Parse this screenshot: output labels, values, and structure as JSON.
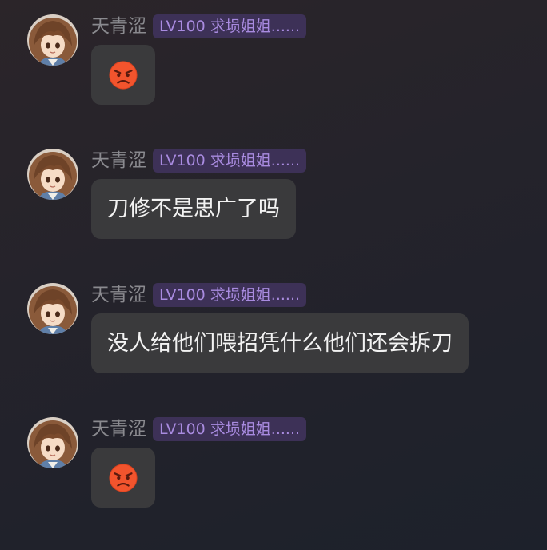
{
  "messages": [
    {
      "sender": "天青涩",
      "badge": "LV100 求埙姐姐......",
      "type": "emoji",
      "emoji": "angry-face"
    },
    {
      "sender": "天青涩",
      "badge": "LV100 求埙姐姐......",
      "type": "text",
      "text": "刀修不是思广了吗"
    },
    {
      "sender": "天青涩",
      "badge": "LV100 求埙姐姐......",
      "type": "text",
      "text": "没人给他们喂招凭什么他们还会拆刀"
    },
    {
      "sender": "天青涩",
      "badge": "LV100 求埙姐姐......",
      "type": "emoji",
      "emoji": "angry-face"
    }
  ],
  "colors": {
    "background": "#25232b",
    "bubble": "#3a3a3c",
    "badge_bg": "#3d3157",
    "badge_text": "#a98be0",
    "name_text": "#8a8a8f"
  }
}
